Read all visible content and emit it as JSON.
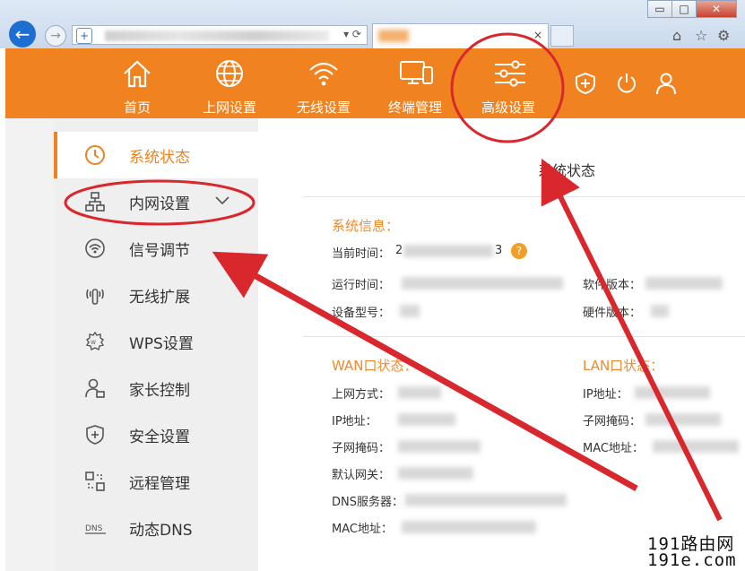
{
  "browser": {
    "win_min": "▭",
    "win_max": "□",
    "win_close": "✕",
    "addr_controls": "▾ ⟳",
    "tab_close": "×",
    "tools": [
      "⌂",
      "☆",
      "⚙"
    ]
  },
  "topnav": {
    "items": [
      {
        "label": "首页",
        "icon": "home-icon"
      },
      {
        "label": "上网设置",
        "icon": "globe-icon"
      },
      {
        "label": "无线设置",
        "icon": "wifi-icon"
      },
      {
        "label": "终端管理",
        "icon": "devices-icon"
      },
      {
        "label": "高级设置",
        "icon": "sliders-icon"
      }
    ],
    "right_icons": [
      "shield-plus-icon",
      "power-icon",
      "user-icon"
    ]
  },
  "sidebar": {
    "items": [
      {
        "label": "系统状态",
        "icon": "clock-icon"
      },
      {
        "label": "内网设置",
        "icon": "network-icon"
      },
      {
        "label": "信号调节",
        "icon": "signal-icon"
      },
      {
        "label": "无线扩展",
        "icon": "wireless-extend-icon"
      },
      {
        "label": "WPS设置",
        "icon": "wps-gear-icon"
      },
      {
        "label": "家长控制",
        "icon": "parent-control-icon"
      },
      {
        "label": "安全设置",
        "icon": "security-shield-icon"
      },
      {
        "label": "远程管理",
        "icon": "remote-icon"
      },
      {
        "label": "动态DNS",
        "icon": "dns-icon"
      }
    ]
  },
  "main": {
    "title": "系统状态",
    "system_info": {
      "heading": "系统信息：",
      "current_time": "当前时间：",
      "current_time_value_start": "2",
      "current_time_value_end": "3",
      "help": "?",
      "uptime": "运行时间：",
      "model": "设备型号：",
      "sw_version": "软件版本：",
      "hw_version": "硬件版本："
    },
    "wan": {
      "heading": "WAN口状态：",
      "fields": [
        "上网方式：",
        "IP地址：",
        "子网掩码：",
        "默认网关：",
        "DNS服务器：",
        "MAC地址："
      ]
    },
    "lan": {
      "heading": "LAN口状态：",
      "fields": [
        "IP地址：",
        "子网掩码：",
        "MAC地址："
      ]
    }
  },
  "watermark": {
    "line1": "191路由网",
    "line2": "191e.com"
  },
  "colors": {
    "accent": "#f0821f",
    "annotation": "#d8282e",
    "section_text": "#f08a2a"
  }
}
